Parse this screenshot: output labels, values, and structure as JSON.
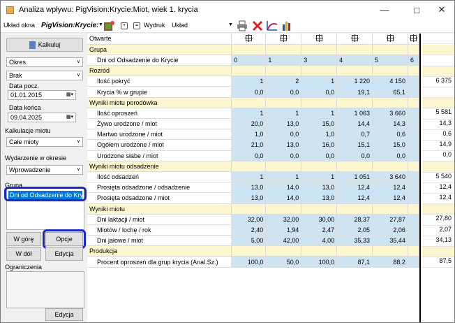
{
  "window": {
    "title": "Analiza wpływu: PigVision:Krycie:Miot, wiek 1. krycia"
  },
  "toolbar": {
    "layout_label": "Układ okna",
    "layout_value": "PigVision:Krycie:M",
    "print_label": "Wydruk",
    "print_value": "Układ",
    "icons": [
      "puzzle-icon",
      "expand-icon",
      "collapse-icon",
      "printer-icon",
      "delete-icon",
      "chart-line-icon",
      "chart-bar-icon"
    ]
  },
  "left": {
    "kalkuluj": "Kalkuluj",
    "okres": "Okres",
    "brak": "Brak",
    "data_pocz_label": "Data pocz.",
    "data_pocz": "01.01.2015",
    "data_konca_label": "Data końca",
    "data_konca": "09.04.2025",
    "kalkulacje_label": "Kalkulacje miotu",
    "kalkulacje_value": "Całe mioty",
    "wydarzenie_label": "Wydarzenie w okresie",
    "wydarzenie_value": "Wprowadzenie",
    "grupa_label": "Grupa",
    "grupa_selected": "Dni od Odsadzenie do Krycie",
    "w_gore": "W górę",
    "opcje": "Opcje",
    "w_dol": "W dół",
    "edycja": "Edycja",
    "ograniczenia_label": "Ograniczenia",
    "edycja2": "Edycja"
  },
  "grid": {
    "header": "Otwarte",
    "rows": [
      {
        "type": "section",
        "label": "Grupa"
      },
      {
        "type": "group",
        "label": "Dni od Odsadzenie do Krycie",
        "values": [
          "0",
          "1",
          "3",
          "4",
          "5",
          "6"
        ],
        "right": ""
      },
      {
        "type": "section",
        "label": "Rozród"
      },
      {
        "type": "data",
        "label": "Ilość pokryć",
        "values": [
          "1",
          "2",
          "1",
          "1 220",
          "4 150"
        ],
        "right": "6 375"
      },
      {
        "type": "data",
        "label": "Krycia % w grupie",
        "values": [
          "0,0",
          "0,0",
          "0,0",
          "19,1",
          "65,1"
        ],
        "right": ""
      },
      {
        "type": "section",
        "label": "Wyniki miotu porodówka"
      },
      {
        "type": "data",
        "label": "Ilość oproszeń",
        "values": [
          "1",
          "1",
          "1",
          "1 063",
          "3 660"
        ],
        "right": "5 581"
      },
      {
        "type": "data",
        "label": "Żywo urodzone / miot",
        "values": [
          "20,0",
          "13,0",
          "15,0",
          "14,4",
          "14,3"
        ],
        "right": "14,3"
      },
      {
        "type": "data",
        "label": "Martwo urodzone / miot",
        "values": [
          "1,0",
          "0,0",
          "1,0",
          "0,7",
          "0,6"
        ],
        "right": "0,6"
      },
      {
        "type": "data",
        "label": "Ogółem urodzone / miot",
        "values": [
          "21,0",
          "13,0",
          "16,0",
          "15,1",
          "15,0"
        ],
        "right": "14,9"
      },
      {
        "type": "data",
        "label": "Urodzone słabe / miot",
        "values": [
          "0,0",
          "0,0",
          "0,0",
          "0,0",
          "0,0"
        ],
        "right": "0,0"
      },
      {
        "type": "section",
        "label": "Wyniki miotu odsadzenie"
      },
      {
        "type": "data",
        "label": "Ilość odsadzeń",
        "values": [
          "1",
          "1",
          "1",
          "1 051",
          "3 640"
        ],
        "right": "5 540"
      },
      {
        "type": "data",
        "label": "Prosięta odsadzone / odsadzenie",
        "values": [
          "13,0",
          "14,0",
          "13,0",
          "12,4",
          "12,4"
        ],
        "right": "12,4"
      },
      {
        "type": "data",
        "label": "Prosięta odsadzone / miot",
        "values": [
          "13,0",
          "14,0",
          "13,0",
          "12,4",
          "12,4"
        ],
        "right": "12,4"
      },
      {
        "type": "section",
        "label": "Wyniki miotu"
      },
      {
        "type": "data",
        "label": "Dni laktacji / miot",
        "values": [
          "32,00",
          "32,00",
          "30,00",
          "28,37",
          "27,87"
        ],
        "right": "27,80"
      },
      {
        "type": "data",
        "label": "Miotów / lochę / rok",
        "values": [
          "2,40",
          "1,94",
          "2,47",
          "2,05",
          "2,06"
        ],
        "right": "2,07"
      },
      {
        "type": "data",
        "label": "Dni jałowe / miot",
        "values": [
          "5,00",
          "42,00",
          "4,00",
          "35,33",
          "35,44"
        ],
        "right": "34,13"
      },
      {
        "type": "section",
        "label": "Produkcja"
      },
      {
        "type": "data",
        "label": "Procent oproszeń dla grup krycia (Anal.Sz.)",
        "values": [
          "100,0",
          "50,0",
          "100,0",
          "87,1",
          "88,2"
        ],
        "right": "87,5"
      }
    ]
  }
}
